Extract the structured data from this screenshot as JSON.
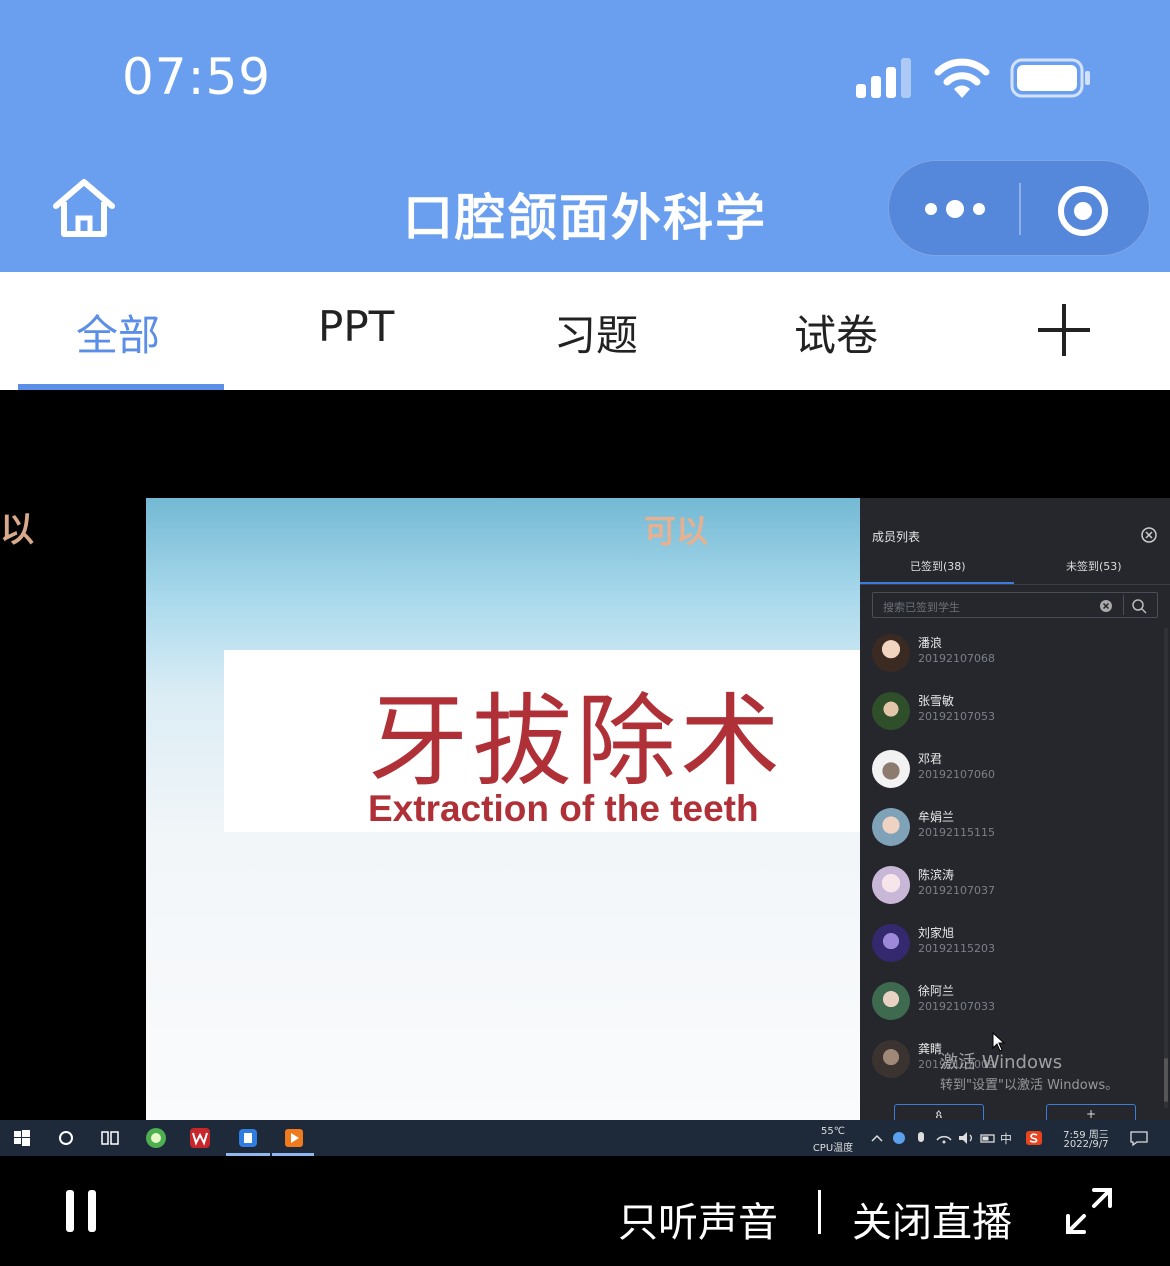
{
  "status_bar": {
    "time": "07:59"
  },
  "nav": {
    "title": "口腔颌面外科学"
  },
  "tabs": [
    {
      "label": "全部",
      "active": true
    },
    {
      "label": "PPT",
      "active": false
    },
    {
      "label": "习题",
      "active": false
    },
    {
      "label": "试卷",
      "active": false
    }
  ],
  "video": {
    "left_fragment": "以",
    "danmu": "可以",
    "slide": {
      "title_cn": "牙拔除术",
      "title_en": "Extraction of the teeth"
    },
    "member_panel": {
      "title": "成员列表",
      "tab_signed": "已签到(38)",
      "tab_unsigned": "未签到(53)",
      "search_placeholder": "搜索已签到学生",
      "members": [
        {
          "name": "潘浪",
          "id": "20192107068"
        },
        {
          "name": "张雪敏",
          "id": "20192107053"
        },
        {
          "name": "邓君",
          "id": "20192107060"
        },
        {
          "name": "牟娟兰",
          "id": "20192115115"
        },
        {
          "name": "陈滨涛",
          "id": "20192107037"
        },
        {
          "name": "刘家旭",
          "id": "20192115203"
        },
        {
          "name": "徐阿兰",
          "id": "20192107033"
        },
        {
          "name": "龚睛",
          "id": "20192107009"
        }
      ],
      "watermark_line1": "激活 Windows",
      "watermark_line2": "转到\"设置\"以激活 Windows。",
      "button_left": "ጰ",
      "button_right": "+"
    },
    "taskbar": {
      "temp_value": "55℃",
      "temp_label": "CPU温度",
      "ime": "中",
      "clock_time": "7:59 周三",
      "clock_date": "2022/9/7"
    }
  },
  "controls": {
    "audio_only": "只听声音",
    "close_live": "关闭直播"
  },
  "colors": {
    "header_blue": "#6a9ff0",
    "tab_active": "#5b8ee6",
    "slide_red": "#b03038"
  }
}
